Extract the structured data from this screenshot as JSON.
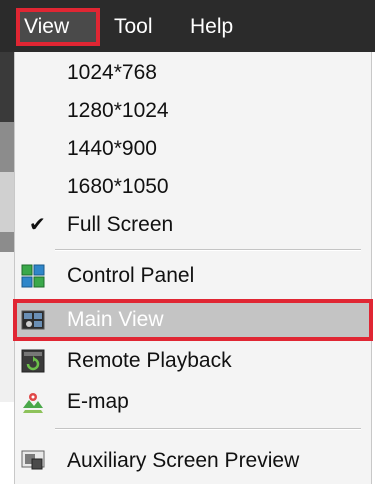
{
  "menubar": {
    "items": [
      {
        "label": "View",
        "active": true
      },
      {
        "label": "Tool",
        "active": false
      },
      {
        "label": "Help",
        "active": false
      }
    ]
  },
  "view_menu": {
    "resolutions": [
      "1024*768",
      "1280*1024",
      "1440*900",
      "1680*1050"
    ],
    "full_screen": {
      "label": "Full Screen",
      "checked": true,
      "icon": "check-icon"
    },
    "panels": [
      {
        "label": "Control Panel",
        "icon": "control-panel-icon"
      },
      {
        "label": "Main View",
        "icon": "main-view-icon",
        "highlighted": true
      },
      {
        "label": "Remote Playback",
        "icon": "remote-playback-icon"
      },
      {
        "label": "E-map",
        "icon": "e-map-icon"
      }
    ],
    "auxiliary": {
      "label": "Auxiliary Screen Preview",
      "icon": "auxiliary-screen-preview-icon"
    }
  },
  "colors": {
    "menubar_bg": "#2b2b2b",
    "menu_bg": "#f4f4f4",
    "highlight_bg": "#c4c4c4",
    "annotation_red": "#e02633"
  }
}
